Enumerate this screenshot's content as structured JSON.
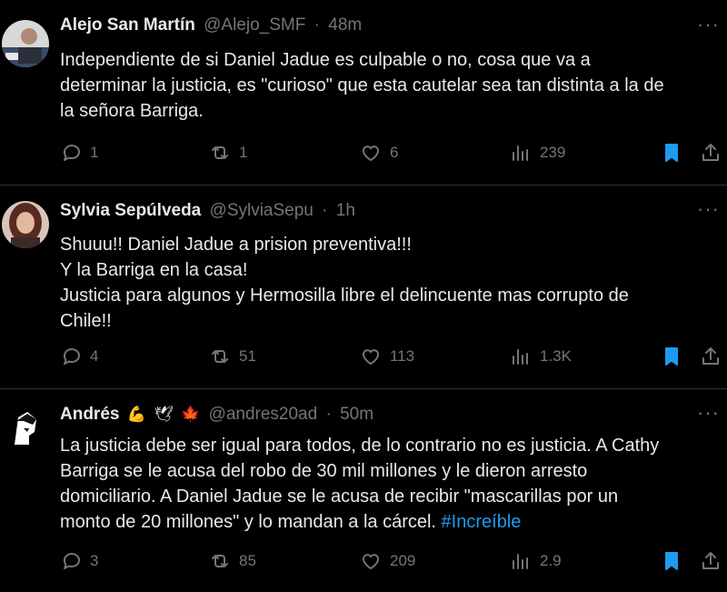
{
  "colors": {
    "accent": "#1d9bf0",
    "muted": "#71767b",
    "text": "#e7e9ea",
    "border": "#2f3336"
  },
  "tweets": [
    {
      "name": "Alejo San Martín",
      "handle": "@Alejo_SMF",
      "time": "48m",
      "lines": [
        "Independiente de si Daniel Jadue es culpable o no, cosa que va a",
        "determinar la justicia, es \"curioso\" que esta cautelar sea tan distinta a la de",
        "la señora Barriga."
      ],
      "replies": "1",
      "reposts": "1",
      "likes": "6",
      "views": "239",
      "icons": [
        "reply-icon",
        "repost-icon",
        "like-icon",
        "views-icon",
        "bookmark-icon",
        "share-icon"
      ]
    },
    {
      "name": "Sylvia Sepúlveda",
      "handle": "@SylviaSepu",
      "time": "1h",
      "lines": [
        "Shuuu!! Daniel Jadue a prision preventiva!!!",
        "Y la Barriga en la casa!",
        "Justicia para algunos y Hermosilla libre el delincuente mas corrupto de",
        "Chile!!"
      ],
      "replies": "4",
      "reposts": "51",
      "likes": "113",
      "views": "1.3K"
    },
    {
      "name": "Andrés",
      "emojis": [
        "💪",
        "🕊",
        "🍁"
      ],
      "handle": "@andres20ad",
      "time": "50m",
      "lines": [
        "La justicia debe ser igual para todos, de lo contrario no es justicia. A Cathy",
        "Barriga se le acusa del robo de 30 mil millones y le dieron arresto",
        "domiciliario. A Daniel Jadue se le acusa de recibir \"mascarillas por un",
        "monto de 20 millones\" y lo mandan a la cárcel. "
      ],
      "hashtag": "#Increíble",
      "replies": "3",
      "reposts": "85",
      "likes": "209",
      "views": "2.9"
    }
  ],
  "dot": "·",
  "more": "···"
}
